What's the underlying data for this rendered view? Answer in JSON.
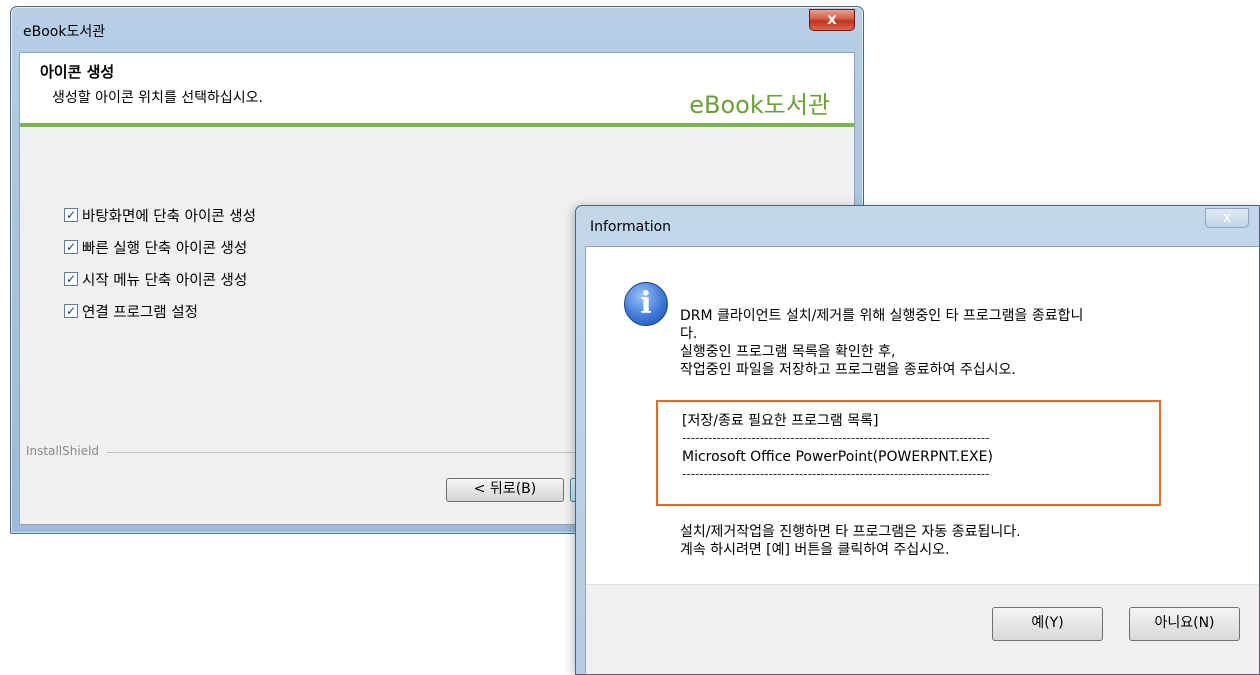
{
  "installer": {
    "title": "eBook도서관",
    "close_glyph": "x",
    "heading": "아이콘 생성",
    "subheading": "생성할 아이콘 위치를 선택하십시오.",
    "logo": "eBook도서관",
    "options": [
      {
        "label": "바탕화면에 단축 아이콘 생성",
        "checked": true
      },
      {
        "label": "빠른 실행 단축 아이콘 생성",
        "checked": true
      },
      {
        "label": "시작 메뉴 단축 아이콘 생성",
        "checked": true
      },
      {
        "label": "연결 프로그램 설정",
        "checked": true
      }
    ],
    "installshield": "InstallShield",
    "back_button": "< 뒤로(B)"
  },
  "info_dialog": {
    "title": "Information",
    "close_glyph": "x",
    "message_lines": [
      "DRM 클라이언트 설치/제거를 위해 실행중인 타 프로그램을 종료합니",
      "다.",
      "실행중인 프로그램 목록을 확인한 후,",
      "작업중인 파일을 저장하고 프로그램을 종료하여 주십시오."
    ],
    "list_title": "[저장/종료 필요한 프로그램 목록]",
    "separator": "-----------------------------------------------------------------------",
    "list_item": "Microsoft Office PowerPoint(POWERPNT.EXE)",
    "notice_lines": [
      "설치/제거작업을 진행하면 타 프로그램은 자동 종료됩니다.",
      "계속 하시려면 [예] 버튼을 클릭하여 주십시오."
    ],
    "yes_button": "예(Y)",
    "no_button": "아니요(N)"
  },
  "colors": {
    "accent_green": "#7ab648",
    "highlight_orange": "#e06b2b",
    "close_red": "#c0351c"
  },
  "icons": {
    "info": "info-icon",
    "checkbox": "checkbox-checked-icon"
  }
}
